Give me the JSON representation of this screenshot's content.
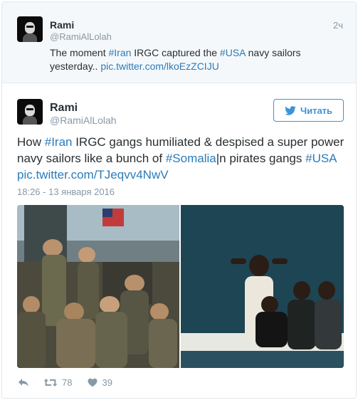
{
  "parent_tweet": {
    "name": "Rami",
    "handle": "@RamiAlLolah",
    "time": "2ч",
    "text_parts": [
      "The moment ",
      "#Iran",
      " IRGC captured the ",
      "#USA",
      " navy sailors yesterday.. ",
      "pic.twitter.com/lkoEzZCIJU"
    ]
  },
  "main_tweet": {
    "name": "Rami",
    "handle": "@RamiAlLolah",
    "follow_label": "Читать",
    "text_parts": [
      "How ",
      "#Iran",
      " IRGC gangs humiliated & despised a super power navy sailors like a bunch of ",
      "#Somalia",
      "|n pirates gangs ",
      "#USA",
      " ",
      "pic.twitter.com/TJeqvv4NwV"
    ],
    "date": "18:26 - 13 января 2016",
    "retweets": "78",
    "likes": "39"
  },
  "colors": {
    "link": "#2b7bb9",
    "follow": "#3b94d9",
    "muted": "#8899a6"
  },
  "icons": [
    "avatar",
    "twitter-bird-icon",
    "reply-icon",
    "retweet-icon",
    "heart-icon"
  ]
}
